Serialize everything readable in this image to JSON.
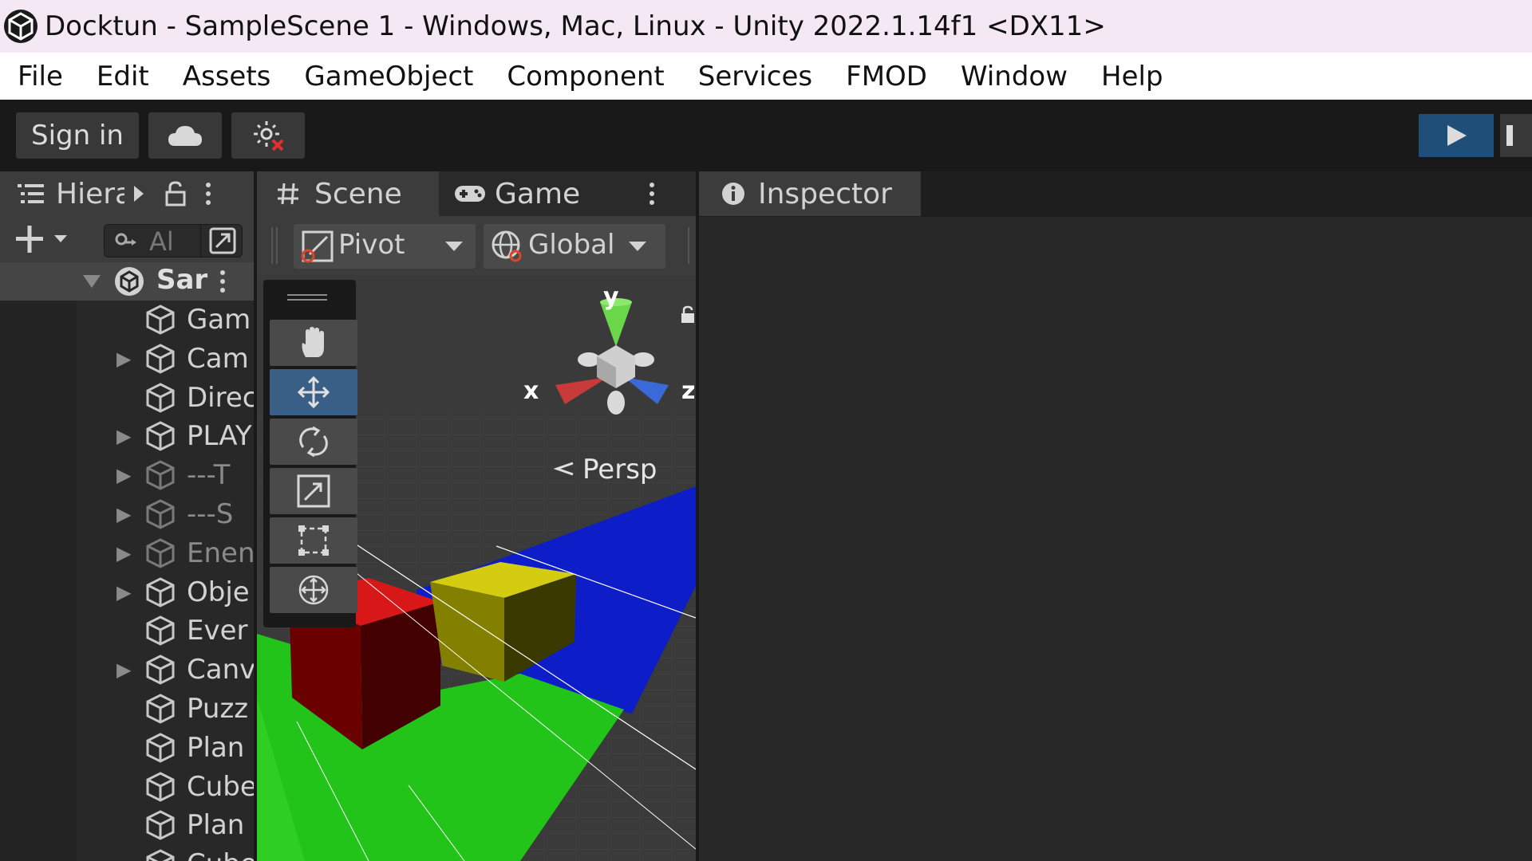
{
  "window": {
    "title": "Docktun - SampleScene 1 - Windows, Mac, Linux - Unity 2022.1.14f1 <DX11>"
  },
  "menu": {
    "items": [
      "File",
      "Edit",
      "Assets",
      "GameObject",
      "Component",
      "Services",
      "FMOD",
      "Window",
      "Help"
    ]
  },
  "toolbar": {
    "sign_in_label": "Sign in"
  },
  "hierarchy": {
    "tab_label": "Hiera",
    "search_placeholder": "Al",
    "scene_label": "Sar",
    "items": [
      {
        "label": "Gam",
        "has_children": false,
        "dim": false
      },
      {
        "label": "Cam",
        "has_children": true,
        "dim": false
      },
      {
        "label": "Direc",
        "has_children": false,
        "dim": false
      },
      {
        "label": "PLAY",
        "has_children": true,
        "dim": false
      },
      {
        "label": "---T",
        "has_children": true,
        "dim": true
      },
      {
        "label": "---S",
        "has_children": true,
        "dim": true
      },
      {
        "label": "Enen",
        "has_children": true,
        "dim": true
      },
      {
        "label": "Obje",
        "has_children": true,
        "dim": false
      },
      {
        "label": "Ever",
        "has_children": false,
        "dim": false
      },
      {
        "label": "Canv",
        "has_children": true,
        "dim": false
      },
      {
        "label": "Puzz",
        "has_children": false,
        "dim": false
      },
      {
        "label": "Plan",
        "has_children": false,
        "dim": false
      },
      {
        "label": "Cube",
        "has_children": false,
        "dim": false
      },
      {
        "label": "Plan",
        "has_children": false,
        "dim": false
      },
      {
        "label": "Cube",
        "has_children": false,
        "dim": false
      }
    ]
  },
  "scene": {
    "tab_scene": "Scene",
    "tab_game": "Game",
    "pivot_label": "Pivot",
    "global_label": "Global",
    "persp_label": "Persp",
    "gizmo": {
      "x": "x",
      "y": "y",
      "z": "z"
    },
    "selected_tool": "move"
  },
  "inspector": {
    "tab_label": "Inspector"
  },
  "colors": {
    "play_button": "#1f4e79",
    "selected_tool": "#3a5f86",
    "ground_green": "#22c41a",
    "plane_blue": "#0d1ec8",
    "cube_red": "#d81818",
    "cube_yellow": "#d4cc10"
  }
}
